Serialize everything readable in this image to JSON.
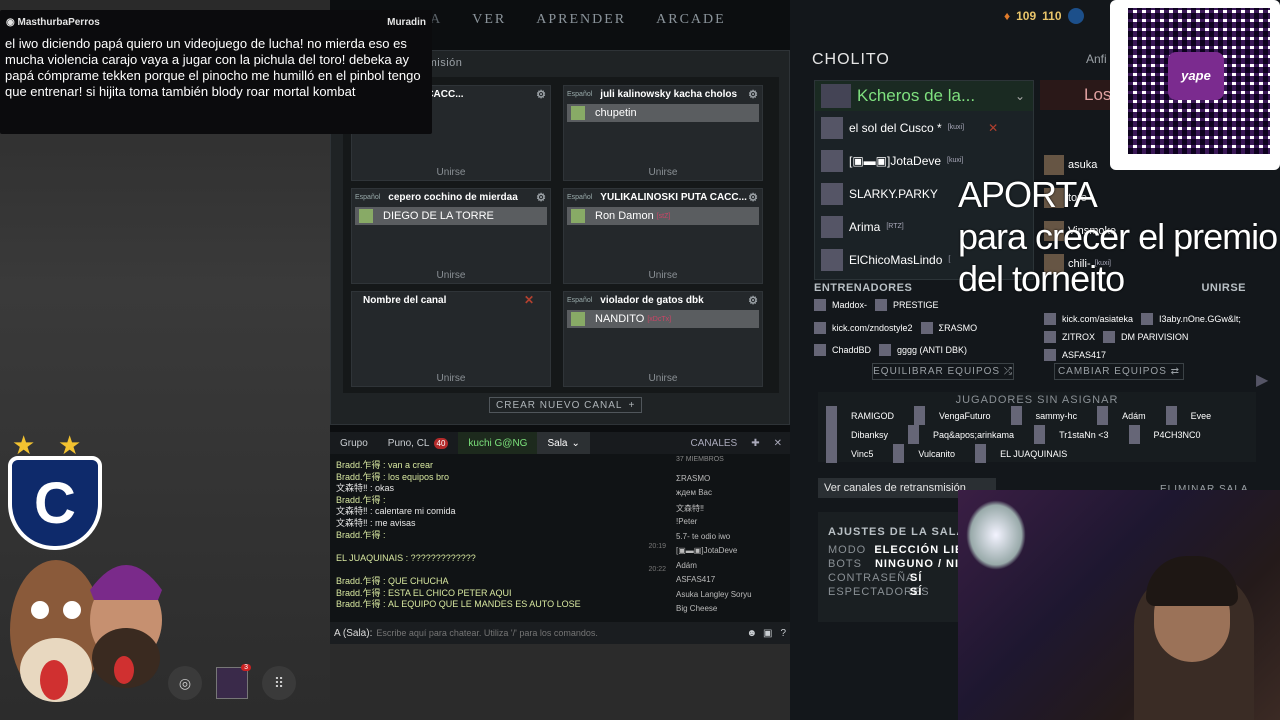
{
  "nav": {
    "items": [
      "ORIA",
      "VER",
      "APRENDER",
      "ARCADE"
    ]
  },
  "overlay_chat": {
    "user": "MasthurbaPerros",
    "right_user": "Muradin",
    "message": "el iwo diciendo papá quiero un videojuego de lucha! no mierda eso es mucha violencia carajo vaya a jugar con la pichula del toro! debeka ay papá cómprame tekken porque el pinocho me humilló en el pinbol tengo que entrenar! si hijita toma también blody roar mortal kombat"
  },
  "channels": {
    "title": "nsmisión",
    "cards": [
      {
        "lang": "",
        "name": "NOSKI PUTA CACC...",
        "member": "",
        "tag": "",
        "join": "Unirse"
      },
      {
        "lang": "Español",
        "name": "juli kalinowsky kacha cholos",
        "member": "chupetin",
        "tag": "",
        "join": "Unirse"
      },
      {
        "lang": "Español",
        "name": "cepero cochino de mierdaa",
        "member": "DIEGO DE LA TORRE",
        "tag": "",
        "join": "Unirse"
      },
      {
        "lang": "Español",
        "name": "YULIKALINOSKI PUTA CACC...",
        "member": "Ron Damon",
        "tag": "[stZ]",
        "join": "Unirse"
      },
      {
        "lang": "",
        "name": "Nombre del canal",
        "member": "",
        "tag": "",
        "join": "Unirse"
      },
      {
        "lang": "Español",
        "name": "violador de gatos dbk",
        "member": "NANDITO",
        "tag": "[xDcTx]",
        "join": "Unirse"
      }
    ],
    "create_label": "CREAR NUEVO CANAL"
  },
  "chat": {
    "tabs": [
      {
        "label": "Grupo"
      },
      {
        "label": "Puno, CL",
        "badge": "40"
      },
      {
        "label": "kuchi G@NG"
      },
      {
        "label": "Sala"
      }
    ],
    "channels_label": "CANALES",
    "lines": [
      "Bradd.乍得 : van a crear",
      "Bradd.乍得 : los equipos bro",
      "文森特‼ : okas",
      "Bradd.乍得 :",
      "文森特‼ : calentare mi comida",
      "文森特‼ : me avisas",
      "Bradd.乍得 :",
      "20:19",
      "EL JUAQUINAIS : ?????????????",
      "20:22",
      "Bradd.乍得 : QUE CHUCHA",
      "Bradd.乍得 : ESTA EL CHICO PETER AQUI",
      "Bradd.乍得 : AL EQUIPO QUE LE MANDES ES AUTO LOSE"
    ],
    "members_count": "37 MIEMBROS",
    "members": [
      "ΣRASMO",
      "ждем Вас",
      "文森特‼",
      "!Peter",
      "5.7- te odio iwo",
      "[▣▬▣]JotaDeve",
      "Adám",
      "ASFAS417",
      "Asuka Langley Soryu",
      "Big Cheese"
    ],
    "input_prefix": "A (Sala):",
    "input_placeholder": "Escribe aquí para chatear. Utiliza '/' para los comandos."
  },
  "lobby": {
    "title": "CHOLITO",
    "host": "Anfi",
    "radiant_name": "Kcheros de la...",
    "dire_name": "Los",
    "radiant": [
      {
        "name": "el sol del Cusco *",
        "tag": "[kuxi]"
      },
      {
        "name": "[▣▬▣]JotaDeve",
        "tag": "[kuxi]"
      },
      {
        "name": "SLARKY.PARKY",
        "tag": ""
      },
      {
        "name": "Arima",
        "tag": "[RTZ]"
      },
      {
        "name": "ElChicoMasLindo",
        "tag": "["
      }
    ],
    "dire": [
      "asuka",
      "toro",
      "Vinsmoke",
      "chili-"
    ],
    "dire_tag": "[kuxi]",
    "coaches_label": "ENTRENADORES",
    "join_label": "UNIRSE",
    "coaches_left": [
      "Maddox-",
      "PRESTIGE",
      "kick.com/zndostyle2",
      "ΣRASMO",
      "ChaddBD",
      "gggg (ANTI DBK)"
    ],
    "coaches_right": [
      "kick.com/asiateka",
      "I3aby.nOne.GGw&lt;",
      "ZITROX",
      "DM PARIVISION",
      "ASFAS417"
    ],
    "balance_label": "EQUILIBRAR EQUIPOS",
    "change_label": "CAMBIAR EQUIPOS",
    "unassigned_label": "JUGADORES SIN ASIGNAR",
    "unassigned": [
      "RAMIGOD",
      "VengaFuturo",
      "sammy-hc",
      "Adám",
      "Evee",
      "Dibanksy",
      "Paq&apos;arinkama",
      "Tr1staNn <3",
      "P4CH3NC0",
      "Vinc5",
      "Vulcanito",
      "EL JUAQUINAIS"
    ],
    "view_channels": "Ver canales de retransmisión",
    "delete_label": "ELIMINAR SALA",
    "settings_title": "AJUSTES DE LA SALA",
    "settings": [
      {
        "k": "MODO",
        "v": "ELECCIÓN LIBI"
      },
      {
        "k": "BOTS",
        "v": "NINGUNO / NIN"
      },
      {
        "k": "CONTRASEÑA",
        "v": "SÍ"
      },
      {
        "k": "ESPECTADORES",
        "v": "SÍ"
      }
    ]
  },
  "resources": {
    "gold": "109",
    "shards": "110"
  },
  "qr": {
    "brand": "yape"
  },
  "overlay_text": {
    "line1": "APORTA",
    "line2": "para crecer el premio",
    "line3": "del torneito"
  },
  "toolbar": {
    "guild_badge": "3"
  }
}
